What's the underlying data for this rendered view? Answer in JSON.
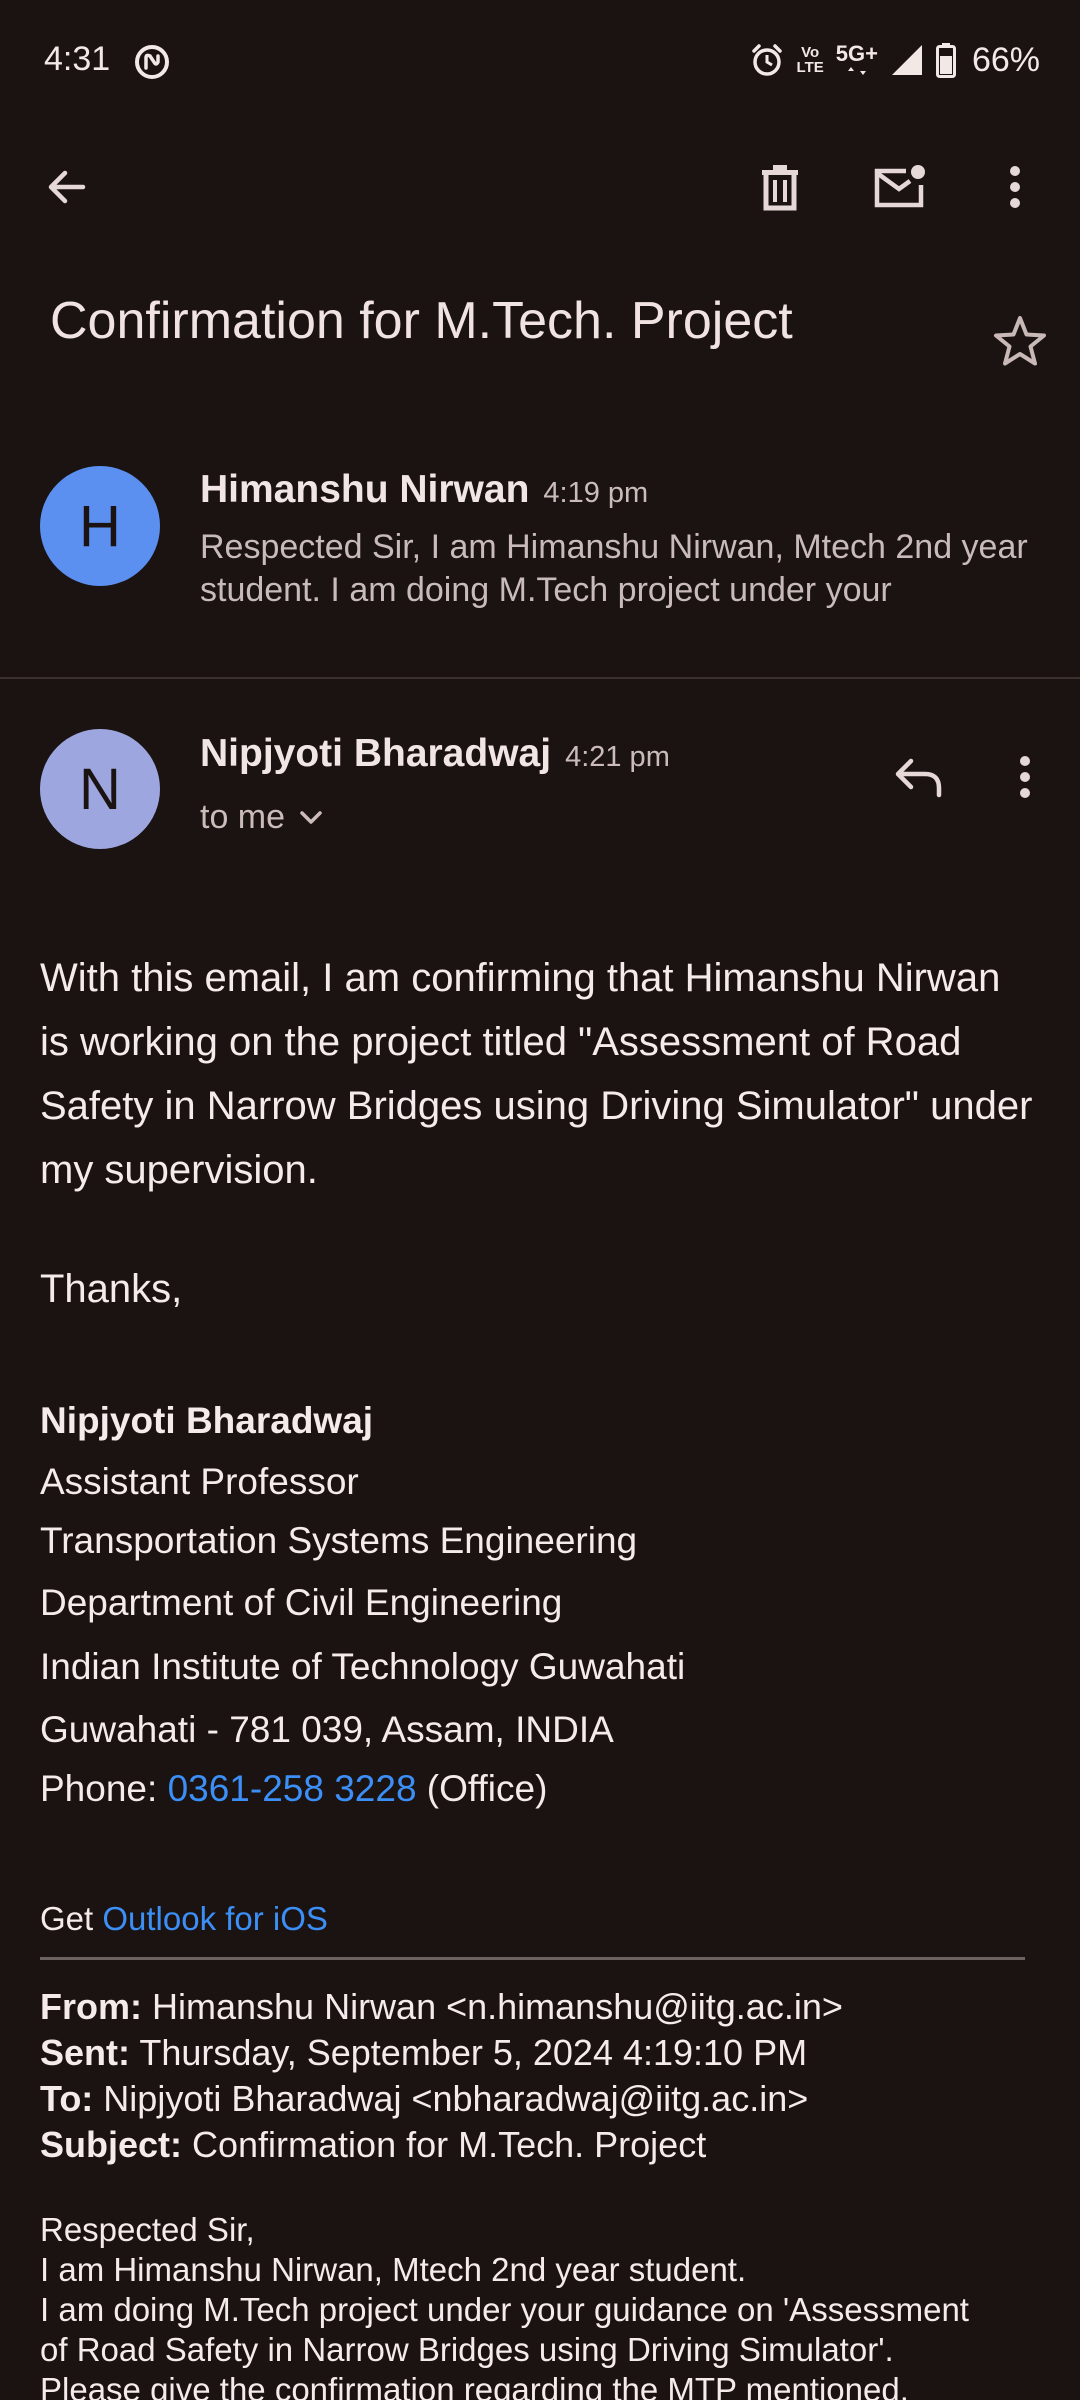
{
  "status_bar": {
    "time": "4:31",
    "lte_top": "Vo",
    "lte_bottom": "LTE",
    "network": "5G+",
    "battery": "66%"
  },
  "toolbar": {
    "icons": [
      "back-arrow-icon",
      "trash-icon",
      "mark-unread-icon",
      "more-vert-icon"
    ]
  },
  "subject": "Confirmation for M.Tech. Project",
  "messages": [
    {
      "avatar_letter": "H",
      "avatar_color": "#5b8ff0",
      "sender": "Himanshu Nirwan",
      "time": "4:19 pm",
      "snippet": "Respected Sir, I am Himanshu Nirwan, Mtech 2nd year student. I am doing M.Tech project under your"
    },
    {
      "avatar_letter": "N",
      "avatar_color": "#9ea6df",
      "sender": "Nipjyoti Bharadwaj",
      "time": "4:21 pm",
      "recipient": "to me"
    }
  ],
  "body": {
    "paragraph": "With this email, I am confirming that Himanshu Nirwan is working on the project titled \"Assessment of Road Safety in Narrow Bridges using Driving Simulator\" under my supervision.",
    "thanks": "Thanks,"
  },
  "signature": {
    "name": "Nipjyoti Bharadwaj",
    "title": "Assistant Professor",
    "group": "Transportation Systems Engineering",
    "department": "Department of Civil Engineering",
    "institute": "Indian Institute of Technology Guwahati",
    "address": "Guwahati - 781 039, Assam, INDIA",
    "phone_label": "Phone: ",
    "phone": "0361-258 3228",
    "phone_suffix": " (Office)"
  },
  "get_outlook": {
    "prefix": "Get ",
    "link": "Outlook for iOS"
  },
  "quoted_header": {
    "from_label": "From:",
    "from_value": " Himanshu Nirwan <n.himanshu@iitg.ac.in>",
    "sent_label": "Sent:",
    "sent_value": " Thursday, September 5, 2024 4:19:10 PM",
    "to_label": "To:",
    "to_value": " Nipjyoti Bharadwaj <nbharadwaj@iitg.ac.in>",
    "subject_label": "Subject:",
    "subject_value": " Confirmation for M.Tech. Project"
  },
  "quoted_body": [
    "Respected Sir,",
    "I am Himanshu Nirwan, Mtech 2nd year student.",
    "I am doing M.Tech project under your guidance on 'Assessment",
    "of Road Safety in Narrow Bridges using Driving Simulator'.",
    "Please give the confirmation regarding the MTP mentioned."
  ],
  "colors": {
    "background": "#1a1312",
    "link": "#3b8ff6",
    "text": "#f4ebea"
  }
}
